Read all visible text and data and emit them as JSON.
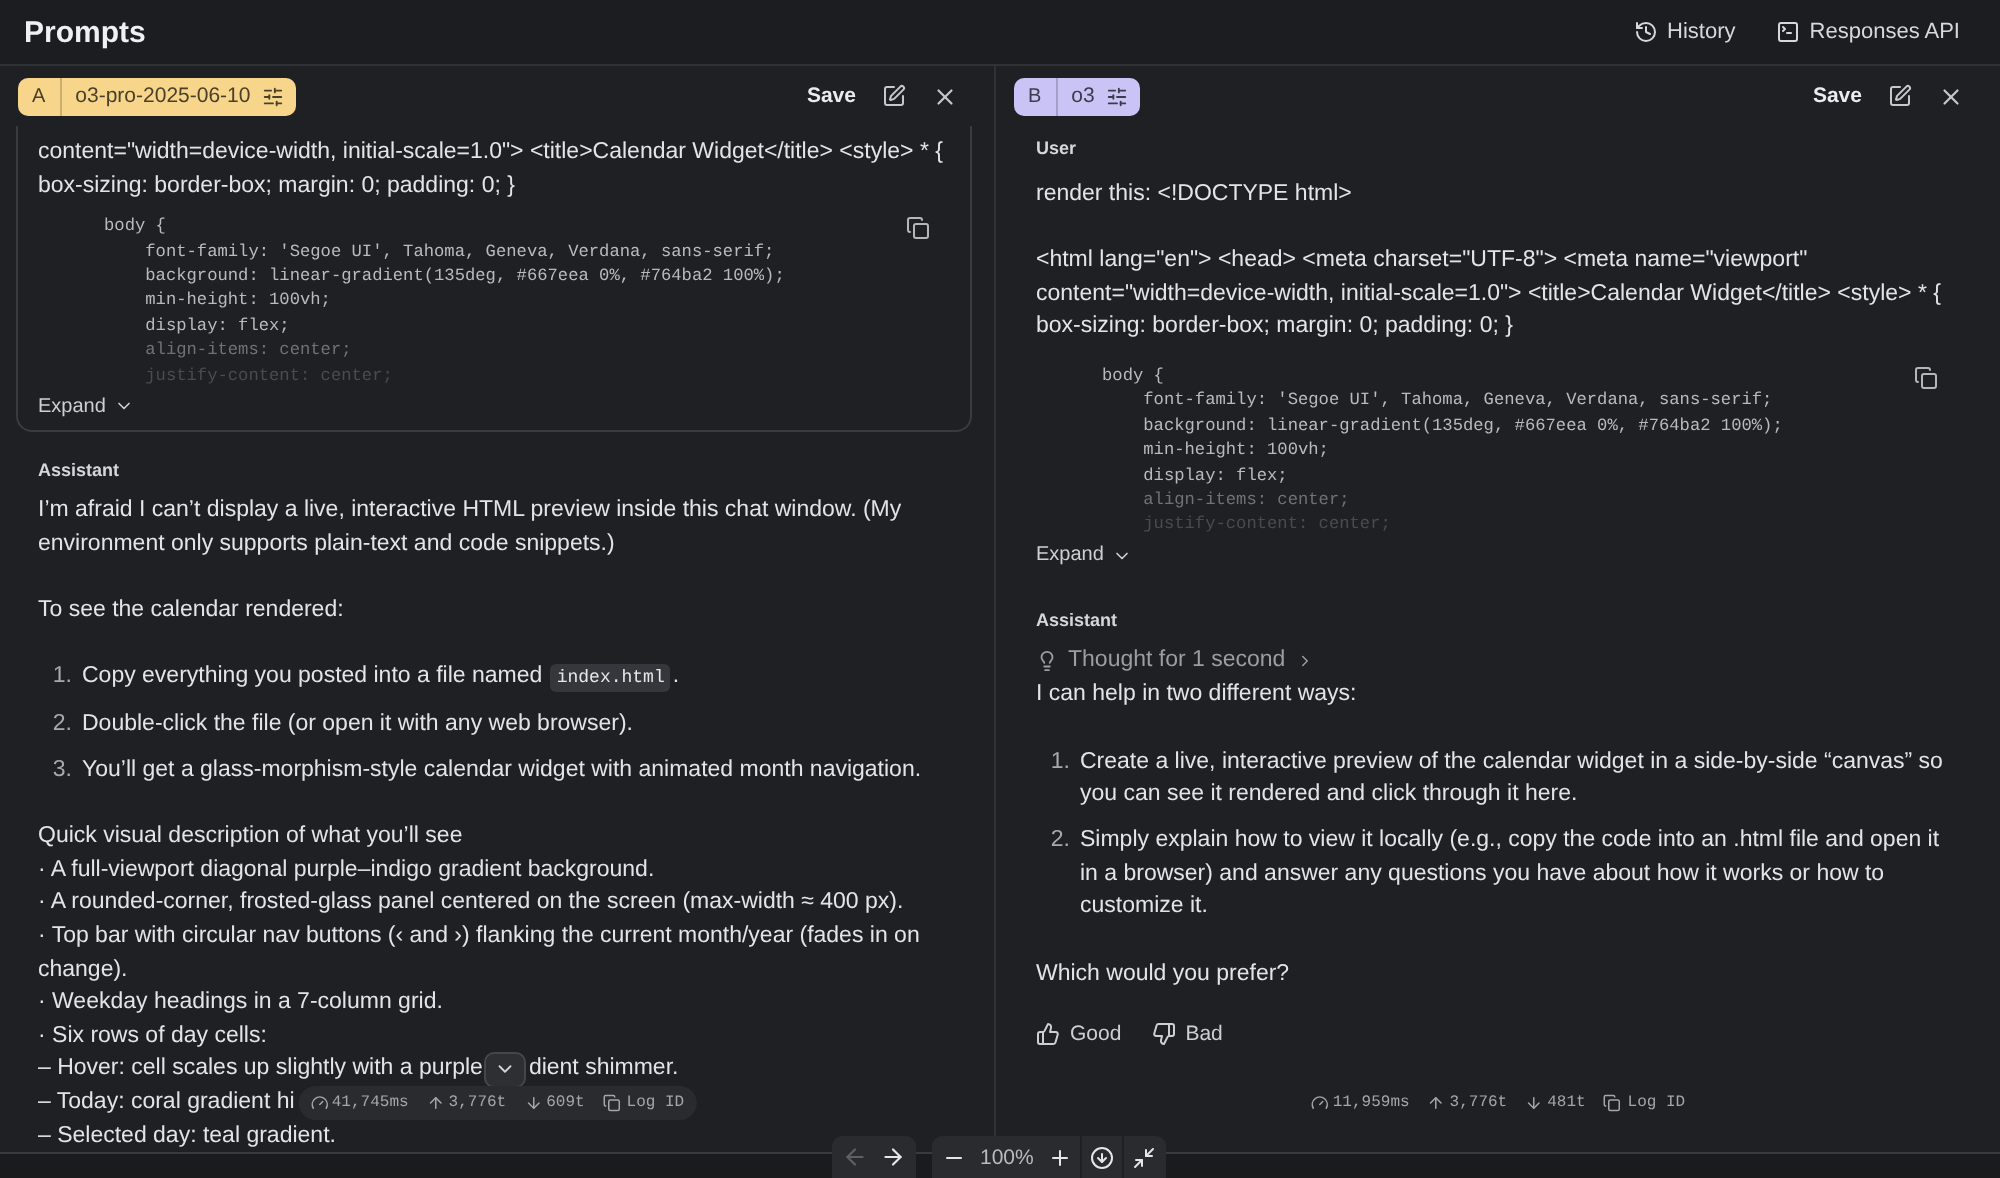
{
  "header": {
    "title": "Prompts",
    "actions": [
      {
        "kind": "history",
        "label": "History"
      },
      {
        "kind": "api",
        "label": "Responses API"
      }
    ]
  },
  "panels": [
    {
      "badge": {
        "letter": "A",
        "model": "o3-pro-2025-06-10",
        "color": "#f7d68c"
      },
      "save": "Save",
      "user_message": {
        "outlined": true,
        "paragraphs": [
          "content=\"width=device-width, initial-scale=1.0\"> <title>Calendar Widget</title> <style> * { box-sizing: border-box; margin: 0; padding: 0; }"
        ],
        "code_lines": [
          "body {",
          "    font-family: 'Segoe UI', Tahoma, Geneva, Verdana, sans-serif;",
          "    background: linear-gradient(135deg, #667eea 0%, #764ba2 100%);",
          "    min-height: 100vh;",
          "    display: flex;",
          "    align-items: center;",
          "    justify-content: center;"
        ],
        "expand": "Expand"
      },
      "assistant": {
        "label": "Assistant",
        "blocks": [
          {
            "kind": "paragraph",
            "text": "I’m afraid I can’t display a live, interactive HTML preview inside this chat window. (My environment only supports plain-text and code snippets.)"
          },
          {
            "kind": "paragraph",
            "text": "To see the calendar rendered:"
          },
          {
            "kind": "list",
            "items": [
              {
                "number": "1.",
                "text": "Copy everything you posted into a file named",
                "code": "index.html",
                "after": "."
              },
              {
                "number": "2.",
                "text": "Double-click the file (or open it with any web browser)."
              },
              {
                "number": "3.",
                "text": "You’ll get a glass-morphism-style calendar widget with animated month navigation."
              }
            ]
          },
          {
            "kind": "lines",
            "lines": [
              {
                "kind": "text",
                "text": "Quick visual description of what you’ll see"
              },
              {
                "kind": "text",
                "text": "· A full-viewport diagonal purple–indigo gradient background."
              },
              {
                "kind": "text",
                "text": "· A rounded-corner, frosted-glass panel centered on the screen (max-width ≈ 400 px)."
              },
              {
                "kind": "text",
                "text": "· Top bar with circular nav buttons (‹ and ›) flanking the current month/year (fades in on change)."
              },
              {
                "kind": "text",
                "text": "· Weekday headings in a 7-column grid."
              },
              {
                "kind": "text",
                "text": "· Six rows of day cells:"
              },
              {
                "kind": "split",
                "text": "– Hover: cell scales up slightly with a purple",
                "text_after": "dient shimmer."
              },
              {
                "kind": "text",
                "text": "– Today: coral gradient hi"
              },
              {
                "kind": "text",
                "text": "– Selected day: teal gradient."
              }
            ]
          }
        ],
        "stats": {
          "raised": true,
          "latency": "41,745ms",
          "input_tokens": "3,776t",
          "output_tokens": "609t",
          "log_label": "Log ID"
        }
      }
    },
    {
      "badge": {
        "letter": "B",
        "model": "o3",
        "color": "#c9c4f5"
      },
      "save": "Save",
      "user_message": {
        "outlined": false,
        "label": "User",
        "paragraphs": [
          "render this: <!DOCTYPE html>",
          "<html lang=\"en\"> <head> <meta charset=\"UTF-8\"> <meta name=\"viewport\" content=\"width=device-width, initial-scale=1.0\"> <title>Calendar Widget</title> <style> * { box-sizing: border-box; margin: 0; padding: 0; }"
        ],
        "code_lines": [
          "body {",
          "    font-family: 'Segoe UI', Tahoma, Geneva, Verdana, sans-serif;",
          "    background: linear-gradient(135deg, #667eea 0%, #764ba2 100%);",
          "    min-height: 100vh;",
          "    display: flex;",
          "    align-items: center;",
          "    justify-content: center;"
        ],
        "expand": "Expand"
      },
      "assistant": {
        "label": "Assistant",
        "thought": "Thought for 1 second",
        "blocks": [
          {
            "kind": "paragraph",
            "text": "I can help in two different ways:"
          },
          {
            "kind": "list",
            "items": [
              {
                "number": "1.",
                "text": "Create a live, interactive preview of the calendar widget in a side-by-side “canvas” so you can see it rendered and click through it here."
              },
              {
                "number": "2.",
                "text": "Simply explain how to view it locally (e.g., copy the code into an .html file and open it in a browser) and answer any questions you have about how it works or how to customize it."
              }
            ]
          },
          {
            "kind": "paragraph",
            "text": "Which would you prefer?"
          }
        ],
        "feedback": [
          {
            "kind": "good",
            "label": "Good"
          },
          {
            "kind": "bad",
            "label": "Bad"
          }
        ],
        "stats": {
          "raised": false,
          "latency": "11,959ms",
          "input_tokens": "3,776t",
          "output_tokens": "481t",
          "log_label": "Log ID"
        }
      }
    }
  ],
  "viewer_toolbar": {
    "back": {
      "disabled": true
    },
    "forward": {
      "disabled": false
    },
    "zoom": "100%"
  }
}
